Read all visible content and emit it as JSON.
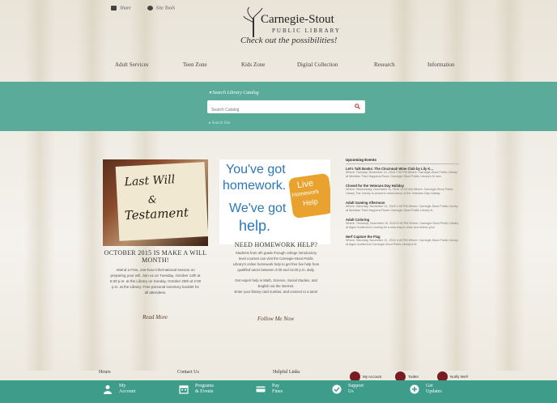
{
  "utility": {
    "share_label": "Share",
    "site_tools_label": "Site Tools"
  },
  "logo": {
    "name": "Carnegie-Stout",
    "sub": "PUBLIC LIBRARY",
    "tagline": "Check out the possibilities!"
  },
  "nav": [
    "Adult Services",
    "Teen Zone",
    "Kids Zone",
    "Digital Collection",
    "Research",
    "Information"
  ],
  "search": {
    "title": "Search Library Catalog",
    "placeholder": "Search Catalog",
    "site_label": "Search Site"
  },
  "feature_left": {
    "img_lines": [
      "Last Will",
      "&",
      "Testament"
    ],
    "heading": "OCTOBER 2015 IS MAKE A WILL MONTH!",
    "body": [
      "Attend a Free, one-hour informational session on",
      "preparing your will. Join us on Tuesday, October 13th at",
      "5:30 p.m. at the Library on Sunday, October 25th at 2:00",
      "p.m. at the Library.  Free personal inventory booklet for",
      "all attendees."
    ],
    "read_more": "Read More"
  },
  "feature_mid": {
    "img_lines": [
      "You've got",
      "homework.",
      "We've got",
      "help."
    ],
    "badge_lines": [
      "Live",
      "Homework",
      "Help"
    ],
    "heading": "NEED HOMEWORK HELP?",
    "body": [
      "Students from 4th grade through college introductory",
      "level courses can visit the Carnegie-Stout Public",
      "Library's online homework help to get free live help from",
      "qualified tutors between 2:00 and 11:00 p.m. daily.",
      "",
      "Get expert help in Math, Science, Social Studies, and",
      "English via the internet.",
      "Enter your library card number, and connect to a tutor!"
    ],
    "read_more": "Follow Me Now"
  },
  "events": {
    "header": "Upcoming Events",
    "items": [
      {
        "title": "Let's Talk Books: The Cincinnati Wine Club by Lily K...",
        "desc": "Where: Tuesday, November 10, 2015 7:00 PM Where: Carnegie-Stout Public Library at Meridian Third Happens Room Carnegie-Stout Public Library's fe men"
      },
      {
        "title": "Closed for the Veterans Day Holiday",
        "desc": "Where: Wednesday, November 11, 2015 12:00 AM Where: Carnegie-Stout Public Library The Library is closed in observance of the Veterans Day holiday."
      },
      {
        "title": "Adult Gaming Afternoon",
        "desc": "Where: Saturday, November 14, 2015 1:00 PM Where: Carnegie-Stout Public Library at Meridian Third Happens Room Carnegie-Stout Public Library fe"
      },
      {
        "title": "Adult Coloring",
        "desc": "Where: Thursday, November 19, 2015 5:30 PM Where: Carnegie-Stout Public Library at Aigen Auditorium Looking for a new way to relax and relieve your"
      },
      {
        "title": "Nerf Capture the Flag",
        "desc": "Where: Saturday, November 21, 2015 4:45 PM Where: Carnegie-Stout Public Library at Aigen Auditorium Carnegie-Stout Public Library's fe"
      }
    ]
  },
  "footer": {
    "hours": "Hours",
    "contact": "Contact Us",
    "helpful": "Helpful Links",
    "social": [
      "My Account",
      "Twitter",
      "Notify Me®"
    ]
  },
  "bottom_bar": [
    {
      "label": "My\nAccount",
      "icon": "person-icon"
    },
    {
      "label": "Programs\n& Events",
      "icon": "calendar-icon"
    },
    {
      "label": "Pay\nFines",
      "icon": "card-icon"
    },
    {
      "label": "Support\nUs",
      "icon": "check-icon"
    },
    {
      "label": "Get\nUpdates",
      "icon": "plus-icon"
    }
  ],
  "colors": {
    "teal_band": "#5aab99",
    "bottom_bar": "#3e9c8b",
    "social_maroon": "#7a1c24"
  }
}
